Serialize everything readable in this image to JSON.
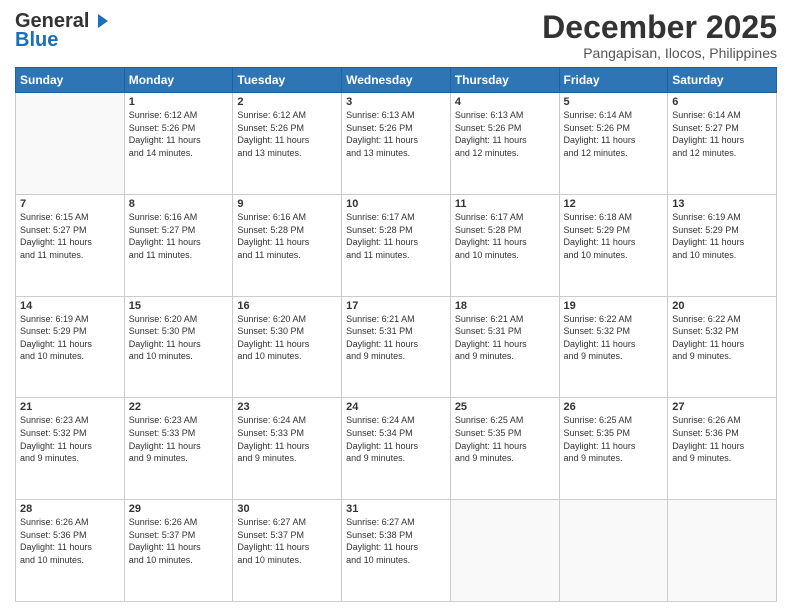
{
  "header": {
    "logo_general": "General",
    "logo_blue": "Blue",
    "month": "December 2025",
    "location": "Pangapisan, Ilocos, Philippines"
  },
  "weekdays": [
    "Sunday",
    "Monday",
    "Tuesday",
    "Wednesday",
    "Thursday",
    "Friday",
    "Saturday"
  ],
  "weeks": [
    [
      {
        "day": "",
        "info": ""
      },
      {
        "day": "1",
        "info": "Sunrise: 6:12 AM\nSunset: 5:26 PM\nDaylight: 11 hours\nand 14 minutes."
      },
      {
        "day": "2",
        "info": "Sunrise: 6:12 AM\nSunset: 5:26 PM\nDaylight: 11 hours\nand 13 minutes."
      },
      {
        "day": "3",
        "info": "Sunrise: 6:13 AM\nSunset: 5:26 PM\nDaylight: 11 hours\nand 13 minutes."
      },
      {
        "day": "4",
        "info": "Sunrise: 6:13 AM\nSunset: 5:26 PM\nDaylight: 11 hours\nand 12 minutes."
      },
      {
        "day": "5",
        "info": "Sunrise: 6:14 AM\nSunset: 5:26 PM\nDaylight: 11 hours\nand 12 minutes."
      },
      {
        "day": "6",
        "info": "Sunrise: 6:14 AM\nSunset: 5:27 PM\nDaylight: 11 hours\nand 12 minutes."
      }
    ],
    [
      {
        "day": "7",
        "info": "Sunrise: 6:15 AM\nSunset: 5:27 PM\nDaylight: 11 hours\nand 11 minutes."
      },
      {
        "day": "8",
        "info": "Sunrise: 6:16 AM\nSunset: 5:27 PM\nDaylight: 11 hours\nand 11 minutes."
      },
      {
        "day": "9",
        "info": "Sunrise: 6:16 AM\nSunset: 5:28 PM\nDaylight: 11 hours\nand 11 minutes."
      },
      {
        "day": "10",
        "info": "Sunrise: 6:17 AM\nSunset: 5:28 PM\nDaylight: 11 hours\nand 11 minutes."
      },
      {
        "day": "11",
        "info": "Sunrise: 6:17 AM\nSunset: 5:28 PM\nDaylight: 11 hours\nand 10 minutes."
      },
      {
        "day": "12",
        "info": "Sunrise: 6:18 AM\nSunset: 5:29 PM\nDaylight: 11 hours\nand 10 minutes."
      },
      {
        "day": "13",
        "info": "Sunrise: 6:19 AM\nSunset: 5:29 PM\nDaylight: 11 hours\nand 10 minutes."
      }
    ],
    [
      {
        "day": "14",
        "info": "Sunrise: 6:19 AM\nSunset: 5:29 PM\nDaylight: 11 hours\nand 10 minutes."
      },
      {
        "day": "15",
        "info": "Sunrise: 6:20 AM\nSunset: 5:30 PM\nDaylight: 11 hours\nand 10 minutes."
      },
      {
        "day": "16",
        "info": "Sunrise: 6:20 AM\nSunset: 5:30 PM\nDaylight: 11 hours\nand 10 minutes."
      },
      {
        "day": "17",
        "info": "Sunrise: 6:21 AM\nSunset: 5:31 PM\nDaylight: 11 hours\nand 9 minutes."
      },
      {
        "day": "18",
        "info": "Sunrise: 6:21 AM\nSunset: 5:31 PM\nDaylight: 11 hours\nand 9 minutes."
      },
      {
        "day": "19",
        "info": "Sunrise: 6:22 AM\nSunset: 5:32 PM\nDaylight: 11 hours\nand 9 minutes."
      },
      {
        "day": "20",
        "info": "Sunrise: 6:22 AM\nSunset: 5:32 PM\nDaylight: 11 hours\nand 9 minutes."
      }
    ],
    [
      {
        "day": "21",
        "info": "Sunrise: 6:23 AM\nSunset: 5:32 PM\nDaylight: 11 hours\nand 9 minutes."
      },
      {
        "day": "22",
        "info": "Sunrise: 6:23 AM\nSunset: 5:33 PM\nDaylight: 11 hours\nand 9 minutes."
      },
      {
        "day": "23",
        "info": "Sunrise: 6:24 AM\nSunset: 5:33 PM\nDaylight: 11 hours\nand 9 minutes."
      },
      {
        "day": "24",
        "info": "Sunrise: 6:24 AM\nSunset: 5:34 PM\nDaylight: 11 hours\nand 9 minutes."
      },
      {
        "day": "25",
        "info": "Sunrise: 6:25 AM\nSunset: 5:35 PM\nDaylight: 11 hours\nand 9 minutes."
      },
      {
        "day": "26",
        "info": "Sunrise: 6:25 AM\nSunset: 5:35 PM\nDaylight: 11 hours\nand 9 minutes."
      },
      {
        "day": "27",
        "info": "Sunrise: 6:26 AM\nSunset: 5:36 PM\nDaylight: 11 hours\nand 9 minutes."
      }
    ],
    [
      {
        "day": "28",
        "info": "Sunrise: 6:26 AM\nSunset: 5:36 PM\nDaylight: 11 hours\nand 10 minutes."
      },
      {
        "day": "29",
        "info": "Sunrise: 6:26 AM\nSunset: 5:37 PM\nDaylight: 11 hours\nand 10 minutes."
      },
      {
        "day": "30",
        "info": "Sunrise: 6:27 AM\nSunset: 5:37 PM\nDaylight: 11 hours\nand 10 minutes."
      },
      {
        "day": "31",
        "info": "Sunrise: 6:27 AM\nSunset: 5:38 PM\nDaylight: 11 hours\nand 10 minutes."
      },
      {
        "day": "",
        "info": ""
      },
      {
        "day": "",
        "info": ""
      },
      {
        "day": "",
        "info": ""
      }
    ]
  ]
}
